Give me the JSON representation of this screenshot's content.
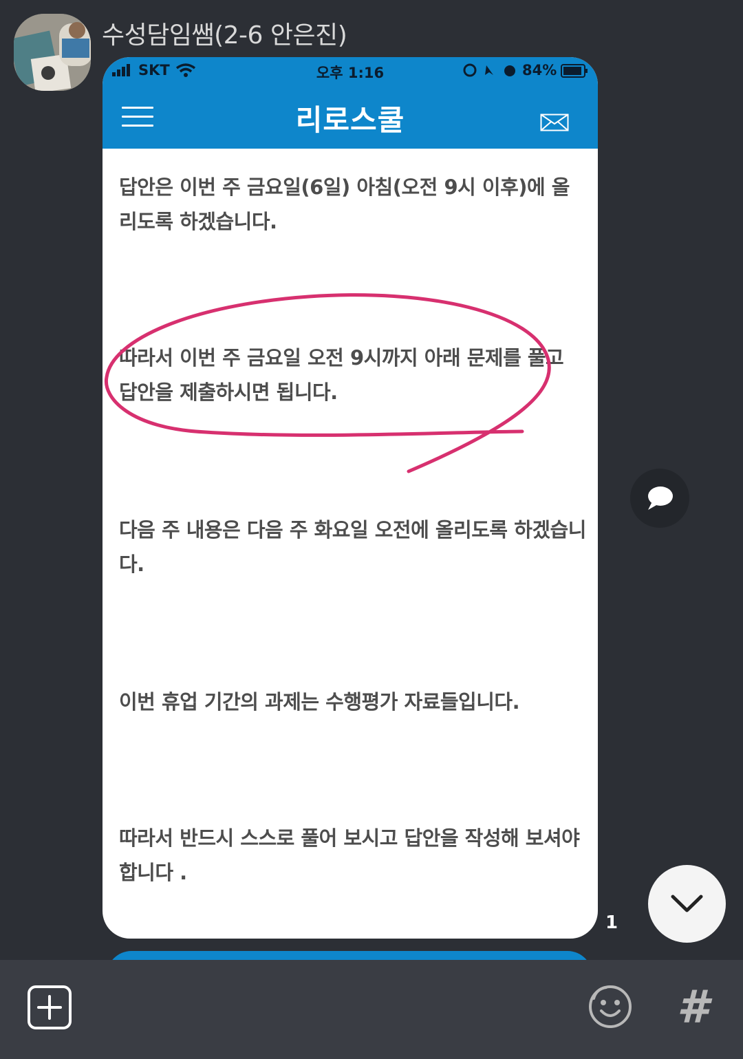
{
  "sender": {
    "name": "수성담임쌤(2-6 안은진)",
    "avatar": "profile-photo"
  },
  "screenshot": {
    "status_bar": {
      "carrier": "SKT",
      "time": "오후 1:16",
      "battery": "84%"
    },
    "app_bar": {
      "title": "리로스쿨",
      "menu_icon": "hamburger-icon",
      "mail_icon": "mail-icon"
    },
    "paragraphs": [
      "답안은 이번 주 금요일(6일) 아침(오전 9시 이후)에 올리도록 하겠습니다.",
      "따라서 이번 주 금요일 오전 9시까지 아래 문제를 풀고 답안을 제출하시면 됩니다.",
      "다음 주 내용은 다음 주 화요일 오전에 올리도록 하겠습니다.",
      "이번 휴업 기간의 과제는 수행평가 자료들입니다.",
      "따라서 반드시 스스로 풀어 보시고 답안을 작성해 보셔야 합니다 ."
    ],
    "highlight_color": "#d7306f"
  },
  "message": {
    "read_count": "1"
  },
  "floating": {
    "comment_icon": "speech-bubble-icon",
    "scroll_down_icon": "chevron-down-icon"
  },
  "input_bar": {
    "plus_icon": "plus-icon",
    "emoji_icon": "emoji-icon",
    "hash_label": "#"
  },
  "colors": {
    "background": "#2c2f35",
    "brand_blue": "#0e86cb",
    "input_bar": "#3a3d44"
  }
}
